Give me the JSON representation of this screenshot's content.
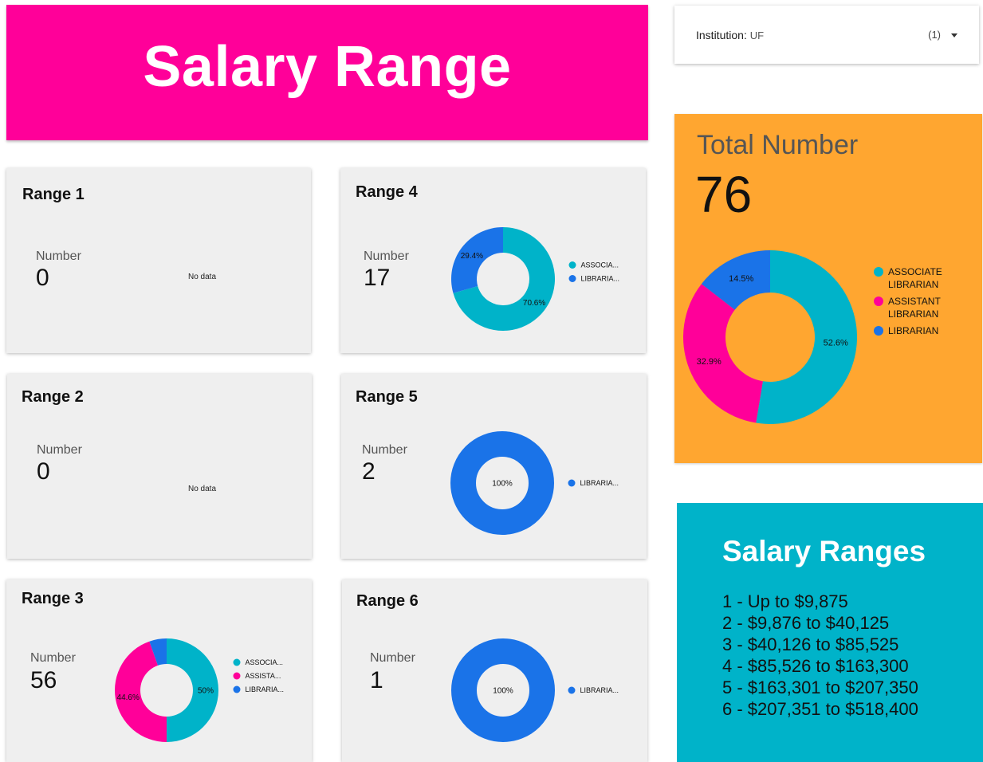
{
  "page_title": "Salary Range",
  "filter": {
    "label": "Institution",
    "value": "UF",
    "count": "(1)"
  },
  "colors": {
    "associate": "#00b3c9",
    "assistant": "#ff0099",
    "librarian": "#1a73e8",
    "banner": "#ff0099",
    "total_bg": "#ffa630"
  },
  "number_label": "Number",
  "no_data_label": "No data",
  "ranges": [
    {
      "title": "Range 1",
      "number": "0"
    },
    {
      "title": "Range 2",
      "number": "0"
    },
    {
      "title": "Range 3",
      "number": "56"
    },
    {
      "title": "Range 4",
      "number": "17"
    },
    {
      "title": "Range 5",
      "number": "2"
    },
    {
      "title": "Range 6",
      "number": "1"
    }
  ],
  "total": {
    "title": "Total Number",
    "value": "76"
  },
  "salary_ranges": {
    "title": "Salary Ranges",
    "items": [
      "1 - Up to $9,875",
      "2 - $9,876 to $40,125",
      "3 - $40,126 to $85,525",
      "4 - $85,526 to $163,300",
      "5 - $163,301 to $207,350",
      "6 - $207,351 to $518,400"
    ]
  },
  "chart_data": [
    {
      "type": "pie",
      "chart": "range-3",
      "categories": [
        "ASSOCIA...",
        "ASSISTA...",
        "LIBRARIA..."
      ],
      "values": [
        50,
        44.6,
        5.4
      ],
      "labels": [
        "50%",
        "44.6%",
        ""
      ],
      "legend": "right"
    },
    {
      "type": "pie",
      "chart": "range-4",
      "categories": [
        "ASSOCIA...",
        "LIBRARIA..."
      ],
      "values": [
        70.6,
        29.4
      ],
      "labels": [
        "70.6%",
        "29.4%"
      ],
      "legend": "right"
    },
    {
      "type": "pie",
      "chart": "range-5",
      "categories": [
        "LIBRARIA..."
      ],
      "values": [
        100
      ],
      "labels": [
        "100%"
      ],
      "legend": "right"
    },
    {
      "type": "pie",
      "chart": "range-6",
      "categories": [
        "LIBRARIA..."
      ],
      "values": [
        100
      ],
      "labels": [
        "100%"
      ],
      "legend": "right"
    },
    {
      "type": "pie",
      "chart": "total",
      "categories": [
        "ASSOCIATE LIBRARIAN",
        "ASSISTANT LIBRARIAN",
        "LIBRARIAN"
      ],
      "values": [
        52.6,
        32.9,
        14.5
      ],
      "labels": [
        "52.6%",
        "32.9%",
        "14.5%"
      ],
      "legend": "right"
    }
  ]
}
